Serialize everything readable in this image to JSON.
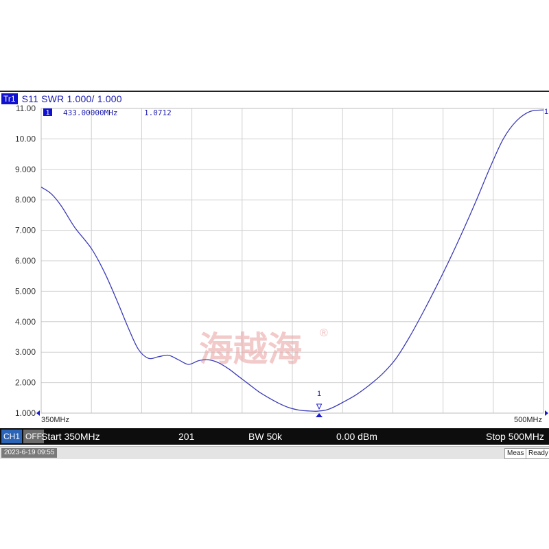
{
  "trace": {
    "badge": "Tr1",
    "title": "S11 SWR 1.000/ 1.000"
  },
  "marker": {
    "number": "1",
    "frequency": "433.00000MHz",
    "value": "1.0712"
  },
  "watermark": "海越海",
  "channel_bar": {
    "channel": "CH1",
    "off": "OFF",
    "start": "Start 350MHz",
    "points": "201",
    "bw": "BW 50k",
    "power": "0.00 dBm",
    "stop": "Stop 500MHz"
  },
  "status_bar": {
    "datetime": "2023-6-19 09:55",
    "meas": "Meas",
    "ready": "Ready"
  },
  "colors": {
    "trace": "#3a3ab8",
    "marker_blue": "#1a1ad0",
    "watermark": "#e8a0a0"
  },
  "chart_data": {
    "type": "line",
    "xlim": [
      350,
      500
    ],
    "ylim": [
      1.0,
      11.0
    ],
    "x_labels": [
      "350MHz",
      "500MHz"
    ],
    "y_ticks": [
      "11.00",
      "10.00",
      "9.000",
      "8.000",
      "7.000",
      "6.000",
      "5.000",
      "4.000",
      "3.000",
      "2.000",
      "1.000"
    ],
    "grid": true,
    "series": [
      {
        "x": [
          350,
          353,
          356,
          360,
          365,
          369,
          373,
          376,
          379,
          382,
          385,
          388,
          391,
          394,
          397,
          400,
          403,
          406,
          409,
          412,
          415,
          418,
          421,
          424,
          427,
          430,
          432,
          433,
          435,
          437,
          440,
          444,
          448,
          452,
          456,
          460,
          464,
          468,
          472,
          476,
          480,
          484,
          488,
          492,
          496,
          500
        ],
        "y": [
          8.42,
          8.2,
          7.8,
          7.1,
          6.4,
          5.6,
          4.6,
          3.8,
          3.1,
          2.8,
          2.85,
          2.9,
          2.75,
          2.6,
          2.72,
          2.75,
          2.65,
          2.45,
          2.2,
          1.95,
          1.7,
          1.5,
          1.32,
          1.18,
          1.1,
          1.07,
          1.06,
          1.07,
          1.1,
          1.18,
          1.35,
          1.6,
          1.92,
          2.3,
          2.8,
          3.5,
          4.3,
          5.15,
          6.05,
          7.0,
          8.0,
          9.05,
          10.0,
          10.6,
          10.9,
          10.95
        ]
      }
    ],
    "markers": [
      {
        "label": "1",
        "x": 433.0,
        "y": 1.0712
      }
    ]
  }
}
